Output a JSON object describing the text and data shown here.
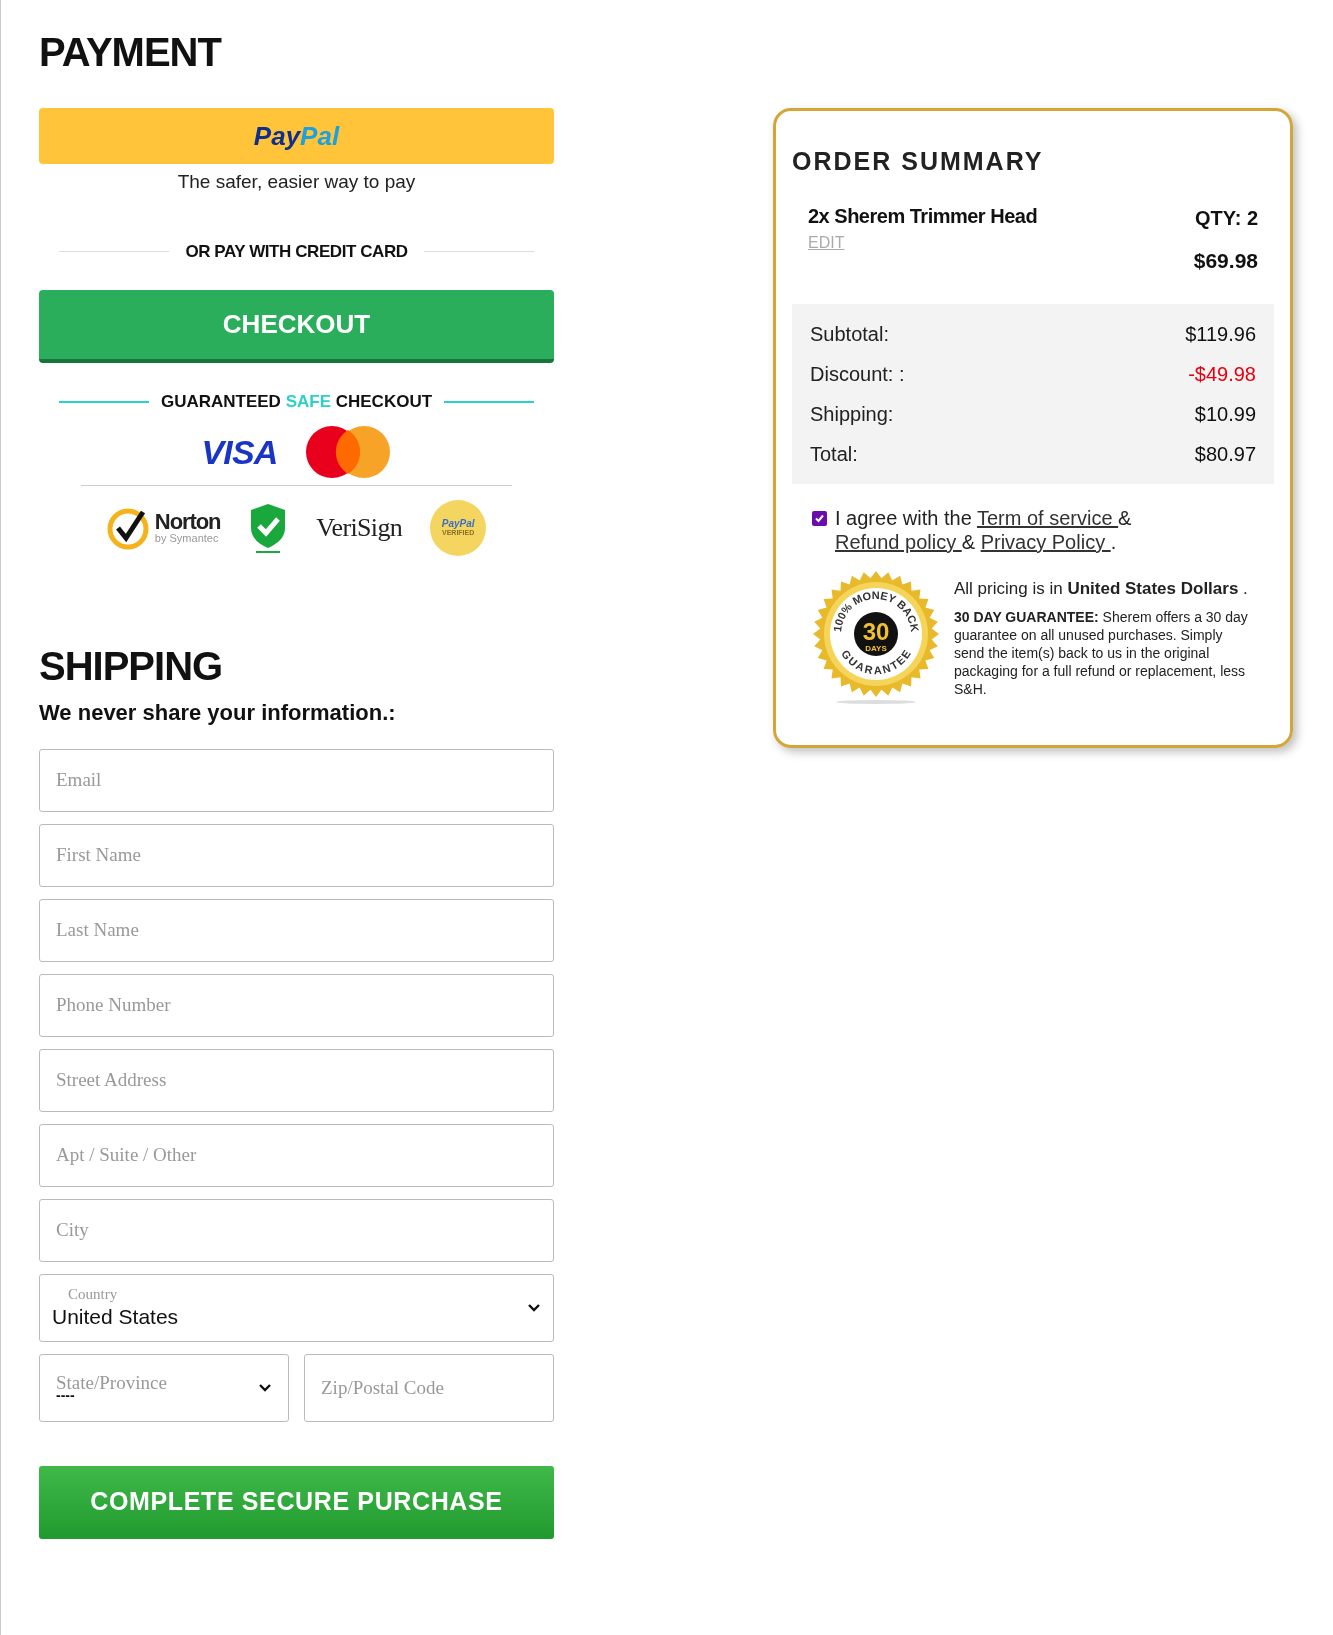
{
  "payment": {
    "title": "PAYMENT",
    "paypal_button": {
      "logo_parts": [
        "Pay",
        "Pal"
      ]
    },
    "paypal_tagline": "The safer, easier way to pay",
    "divider": "OR PAY WITH CREDIT CARD",
    "checkout_button": "CHECKOUT",
    "guarantee_heading": {
      "before": "GUARANTEED",
      "highlight": "SAFE",
      "after": "CHECKOUT"
    },
    "card_logos": [
      {
        "kind": "visa",
        "text": "VISA"
      },
      {
        "kind": "mastercard"
      }
    ],
    "trust_badges": [
      {
        "kind": "norton",
        "text": "Norton",
        "subtext": "by Symantec"
      },
      {
        "kind": "shield"
      },
      {
        "kind": "verisign",
        "text": "VeriSign"
      },
      {
        "kind": "paypal_seal",
        "text": "PayPal",
        "subtext": "VERIFIED"
      }
    ]
  },
  "shipping": {
    "title": "SHIPPING",
    "subtitle": "We never share your information.:",
    "fields": [
      {
        "kind": "text",
        "placeholder": "Email"
      },
      {
        "kind": "text",
        "placeholder": "First Name"
      },
      {
        "kind": "text",
        "placeholder": "Last Name"
      },
      {
        "kind": "text",
        "placeholder": "Phone Number"
      },
      {
        "kind": "text",
        "placeholder": "Street Address"
      },
      {
        "kind": "text",
        "placeholder": "Apt / Suite / Other"
      },
      {
        "kind": "text",
        "placeholder": "City"
      },
      {
        "kind": "select",
        "label": "Country",
        "value": "United States"
      }
    ],
    "state_field": {
      "placeholder": "State/Province",
      "value": "----"
    },
    "zip_field": {
      "placeholder": "Zip/Postal Code"
    },
    "purchase_button": "COMPLETE SECURE PURCHASE"
  },
  "order_summary": {
    "title": "ORDER SUMMARY",
    "item": {
      "name": "2x Sherem Trimmer Head",
      "edit": "EDIT",
      "qty": "QTY: 2",
      "price": "$69.98"
    },
    "totals": [
      {
        "label": "Subtotal:",
        "value": "$119.96",
        "kind": "normal"
      },
      {
        "label": "Discount: :",
        "value": "-$49.98",
        "kind": "discount"
      },
      {
        "label": "Shipping:",
        "value": "$10.99",
        "kind": "normal"
      },
      {
        "label": "Total:",
        "value": "$80.97",
        "kind": "normal"
      }
    ],
    "agree": {
      "checked": true,
      "text": "I agree with the",
      "link1": "Term of service ",
      "amp1": "&",
      "link2": "Refund policy ",
      "amp2": "&",
      "link3": "Privacy Policy ",
      "end": "."
    },
    "seal": {
      "top": "100% MONEY BACK",
      "number": "30",
      "unit": "DAYS",
      "bottom": "GUARANTEE"
    },
    "pricing_note": "All pricing is in **United States Dollars** .",
    "guarantee_note": "**30 DAY GUARANTEE:** Sherem offers a 30 day guarantee on all unused purchases. Simply send the item(s) back to us in the original packaging for a full refund or replacement, less S&H."
  }
}
